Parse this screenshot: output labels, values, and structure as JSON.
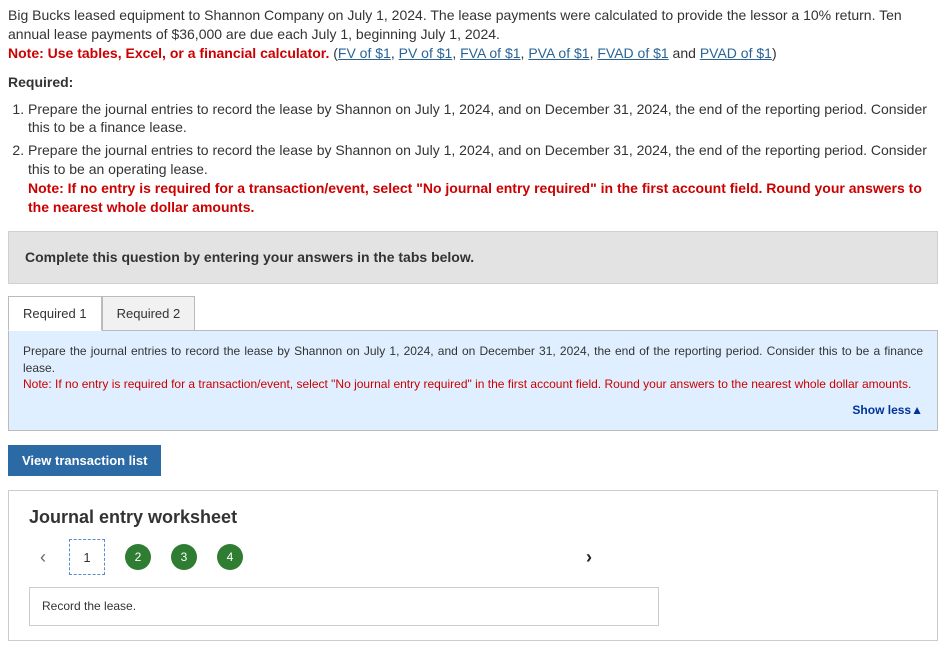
{
  "intro": {
    "text": "Big Bucks leased equipment to Shannon Company on July 1, 2024. The lease payments were calculated to provide the lessor a 10% return. Ten annual lease payments of $36,000 are due each July 1, beginning July 1, 2024.",
    "note_prefix": "Note: Use tables, Excel, or a financial calculator.",
    "links": [
      "FV of $1",
      "PV of $1",
      "FVA of $1",
      "PVA of $1",
      "FVAD of $1",
      "PVAD of $1"
    ]
  },
  "required": {
    "heading": "Required:",
    "items": [
      "Prepare the journal entries to record the lease by Shannon on July 1, 2024, and on December 31, 2024, the end of the reporting period. Consider this to be a finance lease.",
      "Prepare the journal entries to record the lease by Shannon on July 1, 2024, and on December 31, 2024, the end of the reporting period. Consider this to be an operating lease."
    ],
    "inline_note": "Note: If no entry is required for a transaction/event, select \"No journal entry required\" in the first account field. Round your answers to the nearest whole dollar amounts."
  },
  "complete_box": "Complete this question by entering your answers in the tabs below.",
  "tabs": [
    {
      "label": "Required 1",
      "active": true
    },
    {
      "label": "Required 2",
      "active": false
    }
  ],
  "tab_content": {
    "body": "Prepare the journal entries to record the lease by Shannon on July 1, 2024, and on December 31, 2024, the end of the reporting period. Consider this to be a finance lease.",
    "note": "Note: If no entry is required for a transaction/event, select \"No journal entry required\" in the first account field. Round your answers to the nearest whole dollar amounts.",
    "show_less": "Show less"
  },
  "view_btn": "View transaction list",
  "worksheet": {
    "title": "Journal entry worksheet",
    "current_step": "1",
    "steps": [
      "2",
      "3",
      "4"
    ],
    "entry_prompt": "Record the lease."
  }
}
